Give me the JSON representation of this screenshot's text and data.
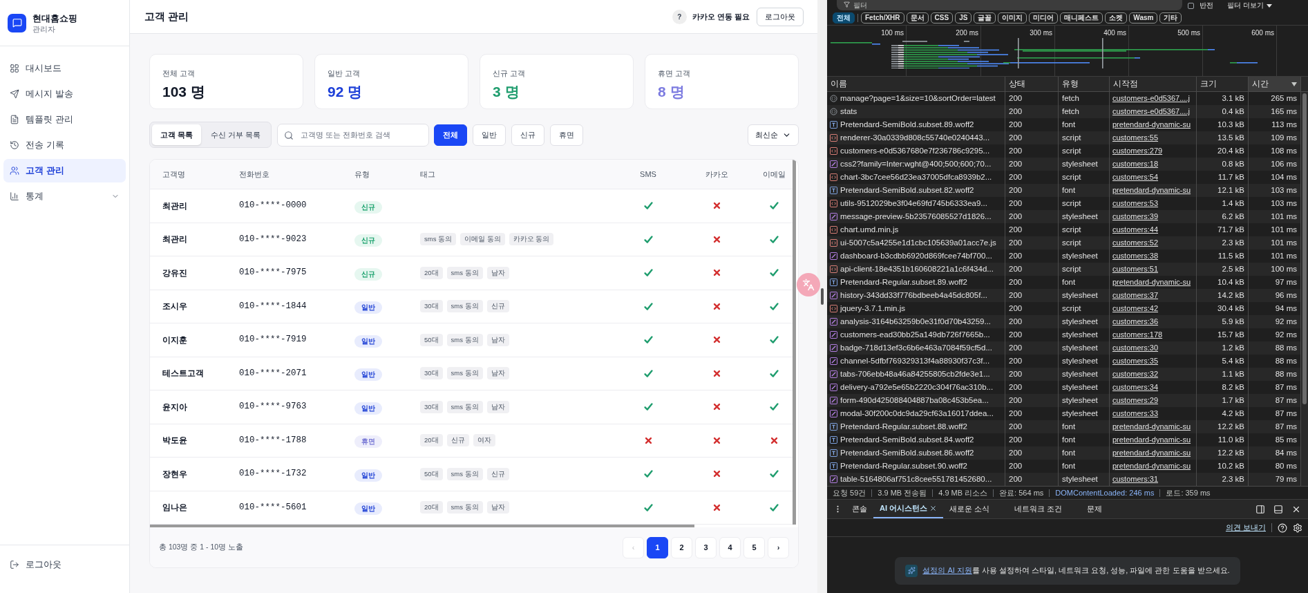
{
  "sidebar": {
    "brand": {
      "name": "현대홈쇼핑",
      "role": "관리자"
    },
    "items": [
      {
        "label": "대시보드",
        "selected": false,
        "expandable": false
      },
      {
        "label": "메시지 발송",
        "selected": false,
        "expandable": false
      },
      {
        "label": "템플릿 관리",
        "selected": false,
        "expandable": false
      },
      {
        "label": "전송 기록",
        "selected": false,
        "expandable": false
      },
      {
        "label": "고객 관리",
        "selected": true,
        "expandable": false
      },
      {
        "label": "통계",
        "selected": false,
        "expandable": true
      }
    ],
    "logout": "로그아웃"
  },
  "header": {
    "title": "고객 관리",
    "help": "?",
    "kakao_status": "카카오 연동 필요",
    "logout": "로그아웃"
  },
  "stats": [
    {
      "label": "전체 고객",
      "value": "103 명",
      "color": "#111827"
    },
    {
      "label": "일반 고객",
      "value": "92 명",
      "color": "#1d3fd8"
    },
    {
      "label": "신규 고객",
      "value": "3 명",
      "color": "#1f9d6e"
    },
    {
      "label": "휴면 고객",
      "value": "8 명",
      "color": "#7c7be0"
    }
  ],
  "list_tabs": [
    {
      "label": "고객 목록",
      "selected": true
    },
    {
      "label": "수신 거부 목록",
      "selected": false
    }
  ],
  "search": {
    "placeholder": "고객명 또는 전화번호 검색"
  },
  "filters": [
    {
      "label": "전체",
      "selected": true
    },
    {
      "label": "일반",
      "selected": false
    },
    {
      "label": "신규",
      "selected": false
    },
    {
      "label": "휴면",
      "selected": false
    }
  ],
  "sort": {
    "value": "최신순"
  },
  "table": {
    "columns": [
      "고객명",
      "전화번호",
      "유형",
      "태그",
      "SMS",
      "카카오",
      "이메일"
    ],
    "rows": [
      {
        "name": "최관리",
        "phone": "010-****-0000",
        "type": {
          "label": "신규",
          "kind": "new"
        },
        "tags": [],
        "sms": true,
        "kakao": false,
        "email": true
      },
      {
        "name": "최관리",
        "phone": "010-****-9023",
        "type": {
          "label": "신규",
          "kind": "new"
        },
        "tags": [
          "sms 동의",
          "이메일 동의",
          "카카오 동의"
        ],
        "sms": true,
        "kakao": false,
        "email": true
      },
      {
        "name": "강유진",
        "phone": "010-****-7975",
        "type": {
          "label": "신규",
          "kind": "new"
        },
        "tags": [
          "20대",
          "sms 동의",
          "남자"
        ],
        "sms": true,
        "kakao": false,
        "email": true
      },
      {
        "name": "조시우",
        "phone": "010-****-1844",
        "type": {
          "label": "일반",
          "kind": "regular"
        },
        "tags": [
          "30대",
          "sms 동의",
          "신규"
        ],
        "sms": true,
        "kakao": false,
        "email": true
      },
      {
        "name": "이지훈",
        "phone": "010-****-7919",
        "type": {
          "label": "일반",
          "kind": "regular"
        },
        "tags": [
          "50대",
          "sms 동의",
          "남자"
        ],
        "sms": true,
        "kakao": false,
        "email": true
      },
      {
        "name": "테스트고객",
        "phone": "010-****-2071",
        "type": {
          "label": "일반",
          "kind": "regular"
        },
        "tags": [
          "30대",
          "sms 동의",
          "남자"
        ],
        "sms": true,
        "kakao": false,
        "email": true
      },
      {
        "name": "윤지아",
        "phone": "010-****-9763",
        "type": {
          "label": "일반",
          "kind": "regular"
        },
        "tags": [
          "30대",
          "sms 동의",
          "남자"
        ],
        "sms": true,
        "kakao": false,
        "email": true
      },
      {
        "name": "박도윤",
        "phone": "010-****-1788",
        "type": {
          "label": "휴면",
          "kind": "dormant"
        },
        "tags": [
          "20대",
          "신규",
          "여자"
        ],
        "sms": false,
        "kakao": false,
        "email": false
      },
      {
        "name": "장현우",
        "phone": "010-****-1732",
        "type": {
          "label": "일반",
          "kind": "regular"
        },
        "tags": [
          "50대",
          "sms 동의",
          "신규"
        ],
        "sms": true,
        "kakao": false,
        "email": true
      },
      {
        "name": "임나은",
        "phone": "010-****-5601",
        "type": {
          "label": "일반",
          "kind": "regular"
        },
        "tags": [
          "20대",
          "sms 동의",
          "남자"
        ],
        "sms": true,
        "kakao": false,
        "email": true
      }
    ]
  },
  "pagination": {
    "summary": "총 103명 중 1 - 10명 노출",
    "prev": "‹",
    "prev_disabled": true,
    "next": "›",
    "pages": [
      {
        "label": "1",
        "selected": true
      },
      {
        "label": "2",
        "selected": false
      },
      {
        "label": "3",
        "selected": false
      },
      {
        "label": "4",
        "selected": false
      },
      {
        "label": "5",
        "selected": false
      }
    ]
  },
  "devtools": {
    "filter": {
      "placeholder": "필터"
    },
    "invert": {
      "label": "반전",
      "checked": false
    },
    "more_filters": "필터 더보기",
    "type_chips": [
      {
        "label": "전체",
        "selected": true
      },
      {
        "label": "Fetch/XHR",
        "selected": false
      },
      {
        "label": "문서",
        "selected": false
      },
      {
        "label": "CSS",
        "selected": false
      },
      {
        "label": "JS",
        "selected": false
      },
      {
        "label": "글꼴",
        "selected": false
      },
      {
        "label": "이미지",
        "selected": false
      },
      {
        "label": "미디어",
        "selected": false
      },
      {
        "label": "매니페스트",
        "selected": false
      },
      {
        "label": "소켓",
        "selected": false
      },
      {
        "label": "Wasm",
        "selected": false
      },
      {
        "label": "기타",
        "selected": false
      }
    ],
    "timeline": {
      "ticks": [
        "100 ms",
        "200 ms",
        "300 ms",
        "400 ms",
        "500 ms",
        "600 ms"
      ]
    },
    "network": {
      "columns": [
        {
          "label": "이름",
          "sorted": false
        },
        {
          "label": "상태",
          "sorted": false
        },
        {
          "label": "유형",
          "sorted": false
        },
        {
          "label": "시작점",
          "sorted": false
        },
        {
          "label": "크기",
          "sorted": false
        },
        {
          "label": "시간",
          "sorted": true
        }
      ],
      "rows": [
        {
          "kind": "fetch",
          "name": "manage?page=1&size=10&sortOrder=latest",
          "status": "200",
          "type": "fetch",
          "initiator": "customers-e0d5367....j",
          "size": "3.1 kB",
          "time": "265 ms"
        },
        {
          "kind": "fetch",
          "name": "stats",
          "status": "200",
          "type": "fetch",
          "initiator": "customers-e0d5367....j",
          "size": "0.4 kB",
          "time": "165 ms"
        },
        {
          "kind": "font",
          "name": "Pretendard-SemiBold.subset.89.woff2",
          "status": "200",
          "type": "font",
          "initiator": "pretendard-dynamic-su",
          "size": "10.3 kB",
          "time": "113 ms"
        },
        {
          "kind": "script",
          "name": "renderer-30a0339d808c55740e0240443...",
          "status": "200",
          "type": "script",
          "initiator": "customers:55",
          "size": "13.5 kB",
          "time": "109 ms"
        },
        {
          "kind": "script",
          "name": "customers-e0d5367680e7f236786c9295...",
          "status": "200",
          "type": "script",
          "initiator": "customers:279",
          "size": "20.4 kB",
          "time": "108 ms"
        },
        {
          "kind": "stylesheet",
          "name": "css2?family=Inter:wght@400;500;600;70...",
          "status": "200",
          "type": "stylesheet",
          "initiator": "customers:18",
          "size": "0.8 kB",
          "time": "106 ms"
        },
        {
          "kind": "script",
          "name": "chart-3bc7cee56d23ea37005dfca8939b2...",
          "status": "200",
          "type": "script",
          "initiator": "customers:54",
          "size": "11.7 kB",
          "time": "104 ms"
        },
        {
          "kind": "font",
          "name": "Pretendard-SemiBold.subset.82.woff2",
          "status": "200",
          "type": "font",
          "initiator": "pretendard-dynamic-su",
          "size": "12.1 kB",
          "time": "103 ms"
        },
        {
          "kind": "script",
          "name": "utils-9512029be3f04e69fd745b6333ea9...",
          "status": "200",
          "type": "script",
          "initiator": "customers:53",
          "size": "1.4 kB",
          "time": "103 ms"
        },
        {
          "kind": "stylesheet",
          "name": "message-preview-5b23576085527d1826...",
          "status": "200",
          "type": "stylesheet",
          "initiator": "customers:39",
          "size": "6.2 kB",
          "time": "101 ms"
        },
        {
          "kind": "script",
          "name": "chart.umd.min.js",
          "status": "200",
          "type": "script",
          "initiator": "customers:44",
          "size": "71.7 kB",
          "time": "101 ms"
        },
        {
          "kind": "script",
          "name": "ui-5007c5a4255e1d1cbc105639a01acc7e.js",
          "status": "200",
          "type": "script",
          "initiator": "customers:52",
          "size": "2.3 kB",
          "time": "101 ms"
        },
        {
          "kind": "stylesheet",
          "name": "dashboard-b3cdbb6920d869fcee74bf700...",
          "status": "200",
          "type": "stylesheet",
          "initiator": "customers:38",
          "size": "11.5 kB",
          "time": "101 ms"
        },
        {
          "kind": "script",
          "name": "api-client-18e4351b160608221a1c6f434d...",
          "status": "200",
          "type": "script",
          "initiator": "customers:51",
          "size": "2.5 kB",
          "time": "100 ms"
        },
        {
          "kind": "font",
          "name": "Pretendard-Regular.subset.89.woff2",
          "status": "200",
          "type": "font",
          "initiator": "pretendard-dynamic-su",
          "size": "10.4 kB",
          "time": "97 ms"
        },
        {
          "kind": "stylesheet",
          "name": "history-343dd33f776bdbeeb4a45dc805f...",
          "status": "200",
          "type": "stylesheet",
          "initiator": "customers:37",
          "size": "14.2 kB",
          "time": "96 ms"
        },
        {
          "kind": "script",
          "name": "jquery-3.7.1.min.js",
          "status": "200",
          "type": "script",
          "initiator": "customers:42",
          "size": "30.4 kB",
          "time": "94 ms"
        },
        {
          "kind": "stylesheet",
          "name": "analysis-3164b63259b0e31f0d70b43259...",
          "status": "200",
          "type": "stylesheet",
          "initiator": "customers:36",
          "size": "5.9 kB",
          "time": "92 ms"
        },
        {
          "kind": "stylesheet",
          "name": "customers-ead30bb25a149db726f7665b...",
          "status": "200",
          "type": "stylesheet",
          "initiator": "customers:178",
          "size": "15.7 kB",
          "time": "92 ms"
        },
        {
          "kind": "stylesheet",
          "name": "badge-718d13ef3c6b6e463a7084f59cf5d...",
          "status": "200",
          "type": "stylesheet",
          "initiator": "customers:30",
          "size": "1.2 kB",
          "time": "88 ms"
        },
        {
          "kind": "stylesheet",
          "name": "channel-5dfbf769329313f4a88930f37c3f...",
          "status": "200",
          "type": "stylesheet",
          "initiator": "customers:35",
          "size": "5.4 kB",
          "time": "88 ms"
        },
        {
          "kind": "stylesheet",
          "name": "tabs-706ebb48a46a84255805cb2fde3e1...",
          "status": "200",
          "type": "stylesheet",
          "initiator": "customers:32",
          "size": "1.1 kB",
          "time": "88 ms"
        },
        {
          "kind": "stylesheet",
          "name": "delivery-a792e5e65b2220c304f76ac310b...",
          "status": "200",
          "type": "stylesheet",
          "initiator": "customers:34",
          "size": "8.2 kB",
          "time": "87 ms"
        },
        {
          "kind": "stylesheet",
          "name": "form-490d425088404887ba08c453b5ea...",
          "status": "200",
          "type": "stylesheet",
          "initiator": "customers:29",
          "size": "1.7 kB",
          "time": "87 ms"
        },
        {
          "kind": "stylesheet",
          "name": "modal-30f200c0dc9da29cf63a16017ddea...",
          "status": "200",
          "type": "stylesheet",
          "initiator": "customers:33",
          "size": "4.2 kB",
          "time": "87 ms"
        },
        {
          "kind": "font",
          "name": "Pretendard-Regular.subset.88.woff2",
          "status": "200",
          "type": "font",
          "initiator": "pretendard-dynamic-su",
          "size": "12.2 kB",
          "time": "87 ms"
        },
        {
          "kind": "font",
          "name": "Pretendard-SemiBold.subset.84.woff2",
          "status": "200",
          "type": "font",
          "initiator": "pretendard-dynamic-su",
          "size": "11.0 kB",
          "time": "85 ms"
        },
        {
          "kind": "font",
          "name": "Pretendard-SemiBold.subset.86.woff2",
          "status": "200",
          "type": "font",
          "initiator": "pretendard-dynamic-su",
          "size": "12.2 kB",
          "time": "84 ms"
        },
        {
          "kind": "font",
          "name": "Pretendard-Regular.subset.90.woff2",
          "status": "200",
          "type": "font",
          "initiator": "pretendard-dynamic-su",
          "size": "10.2 kB",
          "time": "80 ms"
        },
        {
          "kind": "stylesheet",
          "name": "table-5164806af751c8cee551781452680...",
          "status": "200",
          "type": "stylesheet",
          "initiator": "customers:31",
          "size": "2.3 kB",
          "time": "79 ms"
        }
      ]
    },
    "summary": [
      {
        "text": "요청 59건",
        "kind": "plain"
      },
      {
        "text": "3.9 MB 전송됨",
        "kind": "plain"
      },
      {
        "text": "4.9 MB 리소스",
        "kind": "plain"
      },
      {
        "text": "완료: 564 ms",
        "kind": "plain"
      },
      {
        "text": "DOMContentLoaded: 246 ms",
        "kind": "dom_loaded"
      },
      {
        "text": "로드: 359 ms",
        "kind": "plain"
      }
    ],
    "drawer": {
      "tabs": [
        {
          "label": "콘솔",
          "selected": false,
          "closable": false
        },
        {
          "label": "AI 어시스턴스",
          "selected": true,
          "closable": true
        },
        {
          "label": "새로운 소식",
          "selected": false,
          "closable": false
        },
        {
          "label": "네트워크 조건",
          "selected": false,
          "closable": false
        },
        {
          "label": "문제",
          "selected": false,
          "closable": false
        }
      ],
      "feedback_link": "의견 보내기",
      "notice": {
        "link": "설정의 AI 지원",
        "text": "를 사용 설정하여 스타일, 네트워크 요청, 성능, 파일에 관한 도움을 받으세요."
      }
    }
  }
}
